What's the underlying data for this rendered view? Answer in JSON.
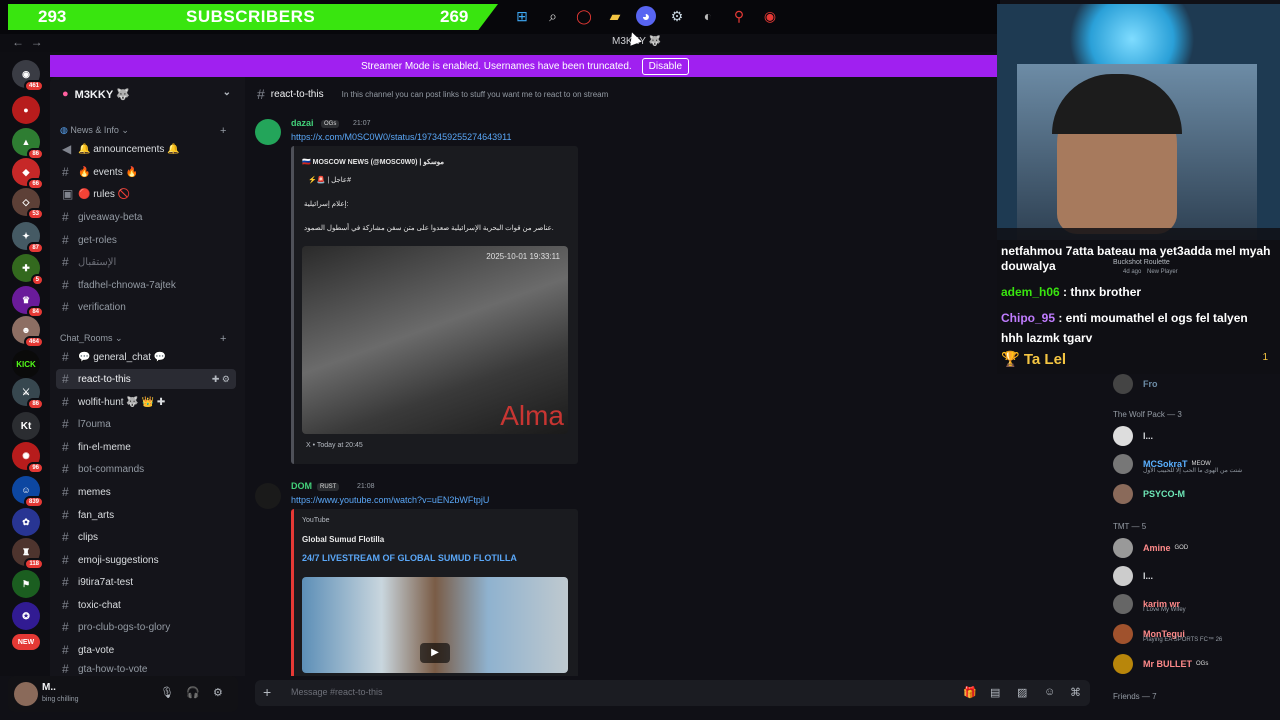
{
  "overlay": {
    "subs_left": "293",
    "subs_label": "SUBSCRIBERS",
    "subs_right": "269"
  },
  "window": {
    "title": "M3KKY 🐺"
  },
  "banner": {
    "text": "Streamer Mode is enabled. Usernames have been truncated.",
    "button": "Disable"
  },
  "rail": {
    "badges": [
      "461",
      "86",
      "66",
      "53",
      "87",
      "5",
      "84",
      "464",
      "86",
      "96",
      "839",
      "118",
      "NEW"
    ],
    "kick": "KICK",
    "kt": "Kt"
  },
  "server": {
    "name": "M3KKY 🐺",
    "categories": [
      {
        "label": "News & Info"
      },
      {
        "label": "Chat_Rooms"
      }
    ],
    "news_channels": [
      "🔔 announcements 🔔",
      "🔥 events 🔥",
      "🔴 rules 🚫",
      "giveaway-beta",
      "get-roles",
      "الإستقبال",
      "tfadhel-chnowa-7ajtek",
      "verification"
    ],
    "chat_channels": [
      "💬 general_chat 💬",
      "react-to-this",
      "wolfit-hunt 🐺 👑 ✚",
      "l7ouma",
      "fin-el-meme",
      "bot-commands",
      "memes",
      "fan_arts",
      "clips",
      "emoji-suggestions",
      "i9tira7at-test",
      "toxic-chat",
      "pro-club-ogs-to-glory",
      "gta-vote",
      "gta-how-to-vote"
    ]
  },
  "user": {
    "name": "M..",
    "status": "bing chilling"
  },
  "channel": {
    "name": "react-to-this",
    "topic": "In this channel you can post links to stuff you want me to react to on stream"
  },
  "messages": [
    {
      "author": "dazai",
      "tag": "OGs",
      "time": "21:07",
      "link": "https://x.com/M0SC0W0/status/1973459255274643911",
      "embed": {
        "source": "🇷🇺 MOSCOW NEWS (@MOSC0W0) | موسكو",
        "line1": "⚡🚨 | عاجل#",
        "line2": "إعلام إسرائيلية:",
        "line3": "عناصر من قوات البحرية الإسرائيلية صعدوا على متن سفن مشاركة في أسطول الصمود.",
        "timestamp": "2025-10-01 19:33:11",
        "watermark": "Alma",
        "footer": "X • Today at 20:45"
      }
    },
    {
      "author": "DOM",
      "tag": "RUST",
      "time": "21:08",
      "link": "https://www.youtube.com/watch?v=uEN2bWFtpjU",
      "embed": {
        "provider": "YouTube",
        "author": "Global Sumud Flotilla",
        "title": "24/7 LIVESTREAM OF GLOBAL SUMUD FLOTILLA"
      }
    }
  ],
  "composer": {
    "placeholder": "Message #react-to-this"
  },
  "stream_chat": [
    {
      "user": "",
      "text": "netfahmou 7atta bateau ma yet3adda mel myah douwalya"
    },
    {
      "user": "adem_h06",
      "text": " : thnx brother"
    },
    {
      "user": "Chipo_95",
      "text": " : enti moumathel el ogs fel talyen hhh lazmk tgarv"
    },
    {
      "user": "",
      "text": "🏆 Ta Lel"
    }
  ],
  "stream_meta": {
    "game": "Buckshot Roulette",
    "ago": "4d ago",
    "new_player": "New Player",
    "count": "1"
  },
  "members": {
    "first": "Fro",
    "groups": [
      {
        "title": "The Wolf Pack — 3",
        "people": [
          {
            "name": "l...",
            "color": "#dbdee1",
            "sub": "",
            "tag": ""
          },
          {
            "name": "MCSokraT",
            "color": "#5ab0ff",
            "sub": "شتت من الهوى ما الحب إلا للحبيب الأول",
            "tag": "MEOW"
          },
          {
            "name": "PSYCO-M",
            "color": "#6ee7b7",
            "sub": "",
            "tag": ""
          }
        ]
      },
      {
        "title": "TMT — 5",
        "people": [
          {
            "name": "Amine",
            "color": "#ff8a8a",
            "sub": "",
            "tag": "GOD"
          },
          {
            "name": "l...",
            "color": "#dbdee1",
            "sub": "",
            "tag": ""
          },
          {
            "name": "karim wr",
            "color": "#ff8a8a",
            "sub": "I Love My Wifey",
            "tag": ""
          },
          {
            "name": "MonTegui",
            "color": "#ff8a8a",
            "sub": "Playing EA SPORTS FC™ 26",
            "tag": ""
          },
          {
            "name": "Mr BULLET",
            "color": "#ff8a8a",
            "sub": "",
            "tag": "OGs"
          }
        ]
      }
    ],
    "friends": "Friends — 7"
  },
  "colors": {
    "banner": "#a020f0",
    "subbar": "#39e50f",
    "link": "#5aa7f7"
  }
}
